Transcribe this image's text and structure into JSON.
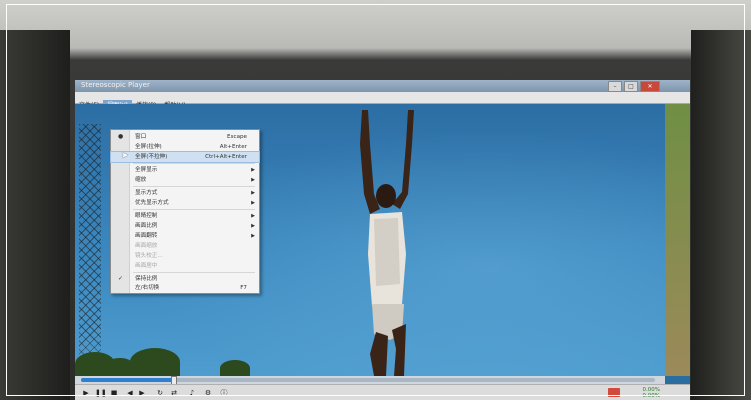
{
  "window": {
    "title": "Stereoscopic Player"
  },
  "controls": {
    "minimize": "–",
    "maximize": "□",
    "close": "✕"
  },
  "menubar": [
    "文件(F)",
    "视图(V)",
    "播放(P)",
    "帮助(H)"
  ],
  "view_menu": [
    {
      "label": "窗口",
      "shortcut": "Escape",
      "check": "●",
      "type": "item"
    },
    {
      "label": "全屏(拉伸)",
      "shortcut": "Alt+Enter",
      "type": "item"
    },
    {
      "label": "全屏(不拉伸)",
      "shortcut": "Ctrl+Alt+Enter",
      "type": "item",
      "highlighted": true
    },
    {
      "type": "separator"
    },
    {
      "label": "全屏显示",
      "submenu": true,
      "type": "item"
    },
    {
      "label": "缩放",
      "submenu": true,
      "type": "item"
    },
    {
      "type": "separator"
    },
    {
      "label": "显示方式",
      "submenu": true,
      "type": "item"
    },
    {
      "label": "优先显示方式",
      "submenu": true,
      "type": "item"
    },
    {
      "type": "separator"
    },
    {
      "label": "眼睛控制",
      "submenu": true,
      "type": "item"
    },
    {
      "label": "画面比例",
      "submenu": true,
      "type": "item"
    },
    {
      "label": "画面翻转",
      "submenu": true,
      "type": "item"
    },
    {
      "label": "画面缩放",
      "type": "item",
      "disabled": true
    },
    {
      "label": "镜头校正...",
      "type": "item",
      "disabled": true
    },
    {
      "label": "画面居中",
      "type": "item",
      "disabled": true
    },
    {
      "type": "separator"
    },
    {
      "label": "保持比例",
      "check": "✓",
      "type": "item"
    },
    {
      "label": "左/右切换",
      "shortcut": "F7",
      "type": "item"
    }
  ],
  "playback": {
    "progress": 0.16
  },
  "status": {
    "line1": "0.00%",
    "line2": "0.00%"
  }
}
